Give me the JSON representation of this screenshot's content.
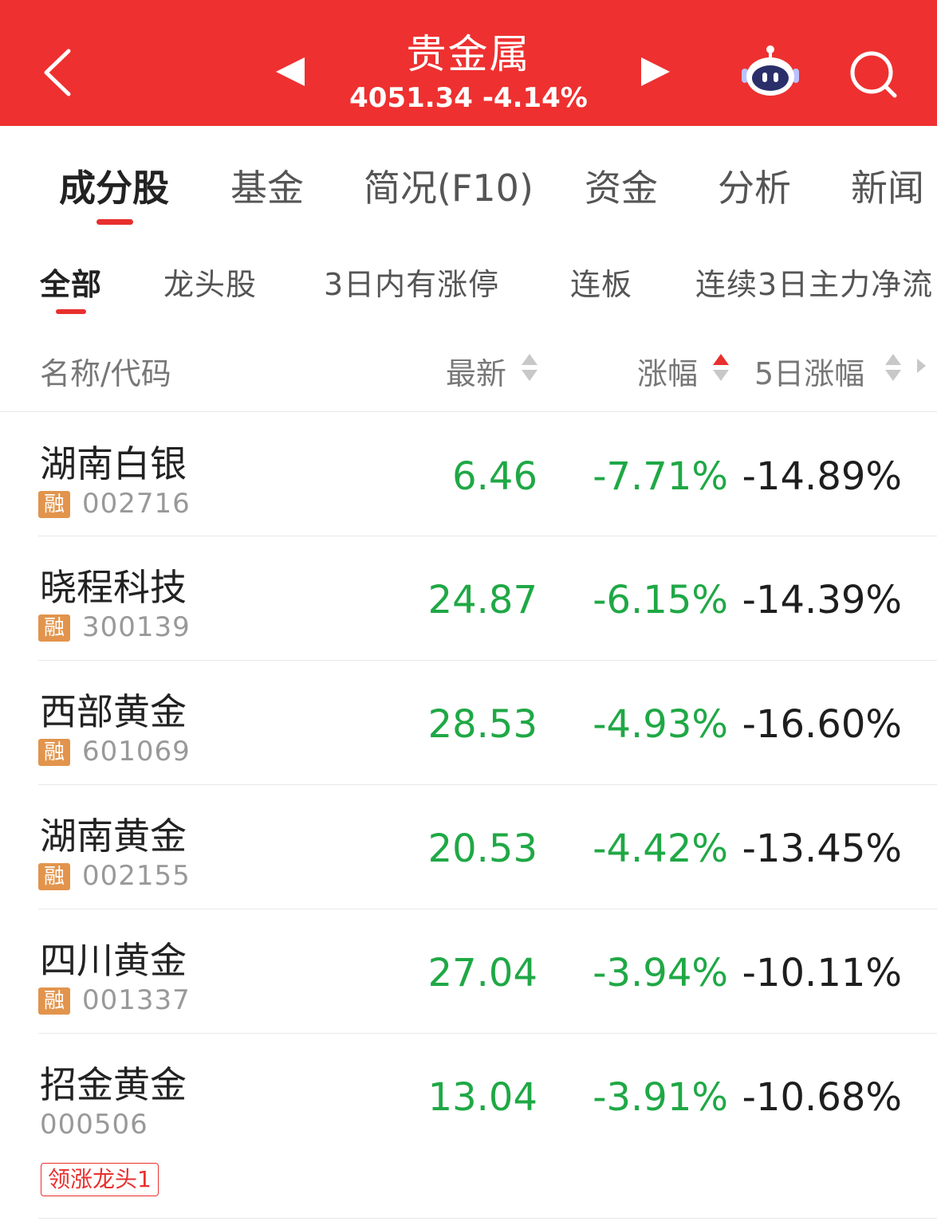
{
  "header": {
    "title": "贵金属",
    "index_value": "4051.34",
    "index_change": "-4.14%"
  },
  "tabs": [
    "成分股",
    "基金",
    "简况(F10)",
    "资金",
    "分析",
    "新闻"
  ],
  "subtabs": [
    "全部",
    "龙头股",
    "3日内有涨停",
    "连板",
    "连续3日主力净流"
  ],
  "table": {
    "columns": {
      "name": "名称/代码",
      "last": "最新",
      "change": "涨幅",
      "change_5d": "5日涨幅"
    },
    "rows": [
      {
        "name": "湖南白银",
        "badge": "融",
        "code": "002716",
        "last": "6.46",
        "change": "-7.71%",
        "change_5d": "-14.89%"
      },
      {
        "name": "晓程科技",
        "badge": "融",
        "code": "300139",
        "last": "24.87",
        "change": "-6.15%",
        "change_5d": "-14.39%"
      },
      {
        "name": "西部黄金",
        "badge": "融",
        "code": "601069",
        "last": "28.53",
        "change": "-4.93%",
        "change_5d": "-16.60%"
      },
      {
        "name": "湖南黄金",
        "badge": "融",
        "code": "002155",
        "last": "20.53",
        "change": "-4.42%",
        "change_5d": "-13.45%"
      },
      {
        "name": "四川黄金",
        "badge": "融",
        "code": "001337",
        "last": "27.04",
        "change": "-3.94%",
        "change_5d": "-10.11%"
      },
      {
        "name": "招金黄金",
        "badge": "",
        "code": "000506",
        "last": "13.04",
        "change": "-3.91%",
        "change_5d": "-10.68%",
        "tag": "领涨龙头1"
      }
    ]
  },
  "colors": {
    "header_bg": "#ee3030",
    "accent_red": "#e8302e",
    "down_green": "#1fa845",
    "badge_orange": "#e2944c"
  },
  "icons": [
    "back-icon",
    "prev-arrow-icon",
    "next-arrow-icon",
    "robot-assistant-icon",
    "search-icon",
    "sort-icon"
  ]
}
